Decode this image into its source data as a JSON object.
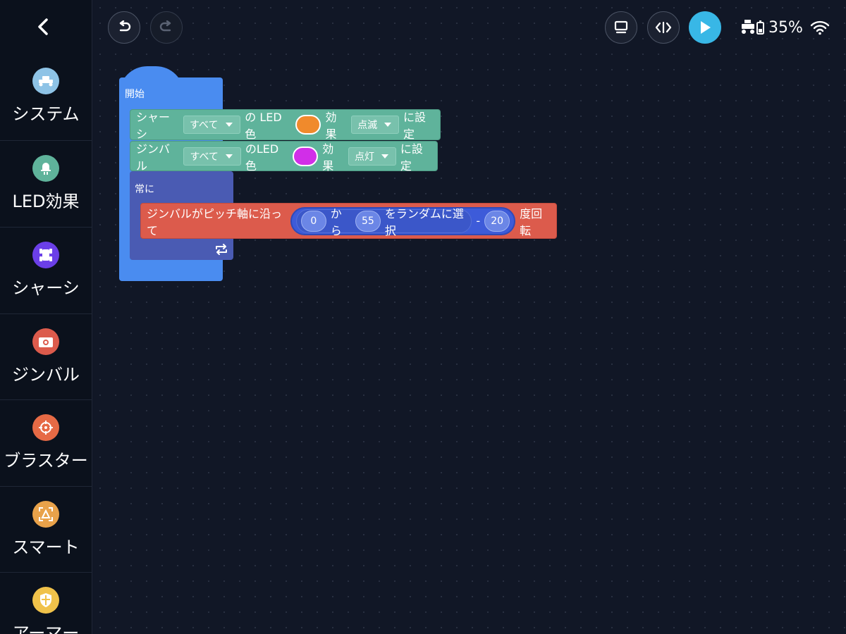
{
  "sidebar": {
    "back_icon": "chevron-left-icon",
    "categories": [
      {
        "label": "システム",
        "icon": "robot-icon",
        "color": "#8ec3e6"
      },
      {
        "label": "LED効果",
        "icon": "led-icon",
        "color": "#5fb39b"
      },
      {
        "label": "シャーシ",
        "icon": "chassis-icon",
        "color": "#6b3fe8"
      },
      {
        "label": "ジンバル",
        "icon": "camera-icon",
        "color": "#dc5b4c"
      },
      {
        "label": "ブラスター",
        "icon": "crosshair-icon",
        "color": "#e66a45"
      },
      {
        "label": "スマート",
        "icon": "smart-icon",
        "color": "#e9a24a"
      },
      {
        "label": "アーマー",
        "icon": "shield-icon",
        "color": "#f0c24a"
      }
    ]
  },
  "toolbar": {
    "undo_icon": "undo-icon",
    "redo_icon": "redo-icon",
    "screen_icon": "screen-icon",
    "code_icon": "code-icon",
    "play_icon": "play-icon",
    "battery": "35%",
    "play_color": "#38b7e6"
  },
  "blocks": {
    "start_label": "開始",
    "chassis_led": {
      "target_label": "シャーシ",
      "part_value": "すべて",
      "led_label": "の LED色",
      "color": "#f08a2c",
      "effect_label": "効果",
      "effect_value": "点滅",
      "set_label": "に設定"
    },
    "gimbal_led": {
      "target_label": "ジンバル",
      "part_value": "すべて",
      "led_label": "のLED色",
      "color": "#d12ee8",
      "effect_label": "効果",
      "effect_value": "点灯",
      "set_label": "に設定"
    },
    "forever_label": "常に",
    "gimbal_rotate": {
      "prefix": "ジンバルがピッチ軸に沿って",
      "from_value": "0",
      "from_label": "から",
      "to_value": "55",
      "random_label": "をランダムに選択",
      "minus": "-",
      "sub_value": "20",
      "suffix": "度回転"
    }
  }
}
